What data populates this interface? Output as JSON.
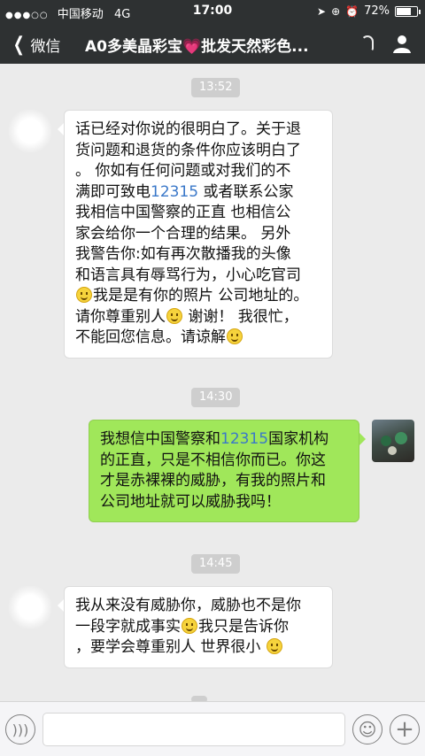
{
  "status_bar": {
    "signal": "●●●○○",
    "carrier": "中国移动",
    "network": "4G",
    "time": "17:00",
    "battery": "72%",
    "battery_level": 0.72
  },
  "nav": {
    "back_label": "微信",
    "title": "A0多美晶彩宝💗批发天然彩色..."
  },
  "messages": [
    {
      "time": "13:52",
      "sender": "other",
      "lines": [
        "话已经对你说的很明白了。关于退",
        "货问题和退货的条件你应该明白了",
        "。 你如有任何问题或对我们的不",
        "满即可致电",
        "我相信中国警察的正直 也相信公",
        "家会给你一个合理的结果。 另外",
        "我警告你:如有再次散播我的头像",
        "和语言具有辱骂行为，小心吃官司",
        "我是是有你的照片 公司地址的。",
        "请你尊重别人",
        "谢谢！ 我很忙，",
        "不能回您信息。请谅解"
      ],
      "link": "12315",
      "after_link": " 或者联系公家"
    },
    {
      "time": "14:30",
      "sender": "me",
      "line1_pre": "我想信中国警察和",
      "link": "12315",
      "line1_post": "国家机构",
      "lines": [
        "的正直，只是不相信你而已。你这",
        "才是赤裸裸的威胁，有我的照片和",
        "公司地址就可以威胁我吗！"
      ]
    },
    {
      "time": "14:45",
      "sender": "other",
      "lines": [
        "我从来没有威胁你，威胁也不是你",
        "一段字就成事实",
        "我只是告诉你",
        "，要学会尊重别人 世界很小"
      ]
    }
  ],
  "icons": {
    "back": "chevron-left-icon",
    "listen": "ear-icon",
    "contact": "person-icon",
    "voice": "voice-icon",
    "emoji": "smile-icon",
    "more": "plus-icon"
  },
  "colors": {
    "bar": "#2e3132",
    "background": "#ebebeb",
    "my_bubble": "#a0e75a",
    "link": "#3a78c9"
  }
}
